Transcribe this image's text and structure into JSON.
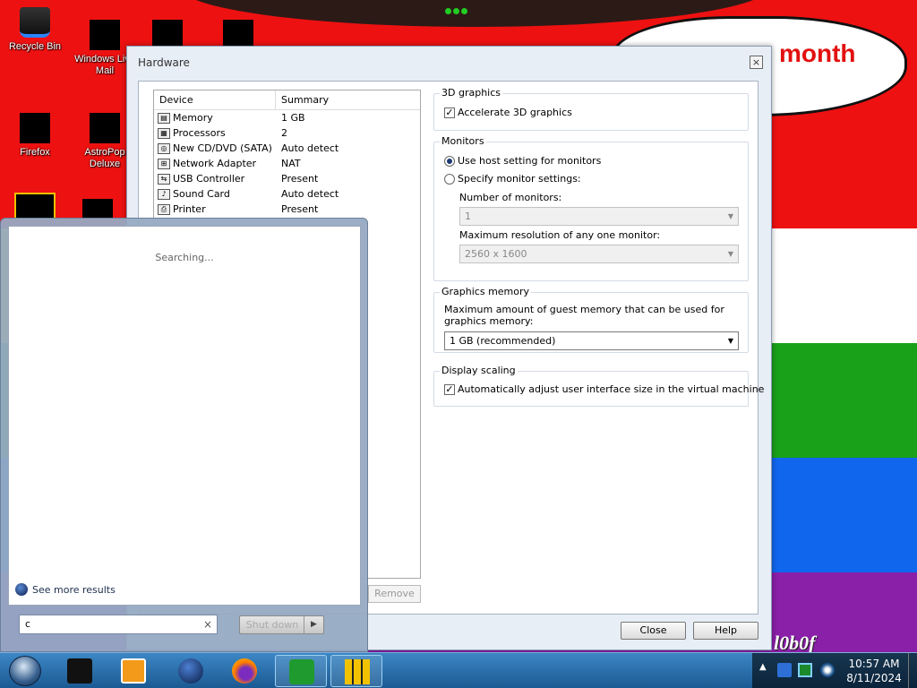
{
  "wallpaper": {
    "speech_text": "month",
    "scribble": "l0b0f",
    "colors": {
      "red": "#ee1111",
      "yellow": "#ffd400",
      "green": "#1aa11a",
      "blue": "#1166ee",
      "purple": "#8a1fa8"
    }
  },
  "desktop_icons": [
    {
      "label": "Recycle Bin",
      "icon": "recycle-bin-icon"
    },
    {
      "label": "Windows Live Mail",
      "icon": "windows-live-mail-icon"
    },
    {
      "label": "Firefox",
      "icon": "firefox-icon"
    },
    {
      "label": "AstroPop Deluxe",
      "icon": "astropop-icon"
    }
  ],
  "dialog": {
    "title": "Hardware",
    "close_glyph": "×",
    "device_list": {
      "headers": [
        "Device",
        "Summary"
      ],
      "rows": [
        {
          "device": "Memory",
          "summary": "1 GB",
          "icon": "memory-icon"
        },
        {
          "device": "Processors",
          "summary": "2",
          "icon": "processor-icon"
        },
        {
          "device": "New CD/DVD (SATA)",
          "summary": "Auto detect",
          "icon": "cd-dvd-icon"
        },
        {
          "device": "Network Adapter",
          "summary": "NAT",
          "icon": "network-adapter-icon"
        },
        {
          "device": "USB Controller",
          "summary": "Present",
          "icon": "usb-icon"
        },
        {
          "device": "Sound Card",
          "summary": "Auto detect",
          "icon": "sound-card-icon"
        },
        {
          "device": "Printer",
          "summary": "Present",
          "icon": "printer-icon"
        }
      ]
    },
    "remove_label": "Remove",
    "graphics_3d": {
      "title": "3D graphics",
      "accelerate_label": "Accelerate 3D graphics",
      "accelerate_checked": true
    },
    "monitors": {
      "title": "Monitors",
      "use_host_label": "Use host setting for monitors",
      "specify_label": "Specify monitor settings:",
      "selected": "use_host",
      "num_monitors_label": "Number of monitors:",
      "num_monitors_value": "1",
      "max_res_label": "Maximum resolution of any one monitor:",
      "max_res_value": "2560 x 1600"
    },
    "graphics_memory": {
      "title": "Graphics memory",
      "description": "Maximum amount of guest memory that can be used for graphics memory:",
      "value": "1 GB (recommended)"
    },
    "display_scaling": {
      "title": "Display scaling",
      "auto_adjust_label": "Automatically adjust user interface size in the virtual machine",
      "auto_adjust_checked": true
    },
    "buttons": {
      "close": "Close",
      "help": "Help"
    }
  },
  "start_menu": {
    "searching_text": "Searching...",
    "see_more": "See more results",
    "search_value": "c",
    "clear_glyph": "×",
    "shutdown_label": "Shut down",
    "shutdown_arrow": "▶"
  },
  "taskbar": {
    "items": [
      {
        "icon": "black-app-icon"
      },
      {
        "icon": "media-player-icon"
      },
      {
        "icon": "globe-icon"
      },
      {
        "icon": "firefox-icon"
      },
      {
        "icon": "download-manager-icon",
        "active": true
      },
      {
        "icon": "yellow-app-icon",
        "active": true
      }
    ],
    "tray_up": "▲",
    "time": "10:57 AM",
    "date": "8/11/2024"
  }
}
